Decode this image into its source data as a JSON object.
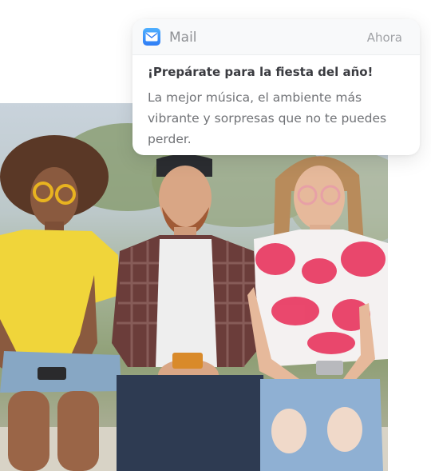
{
  "notification": {
    "app_name": "Mail",
    "app_icon": "mail-icon",
    "timestamp": "Ahora",
    "title": "¡Prepárate para la fiesta del año!",
    "body": "La mejor música, el ambiente más vibrante y sorpresas que no te puedes perder."
  },
  "photo": {
    "subject": "three-friends-looking-at-phones"
  },
  "colors": {
    "mail_icon_top": "#4fb0ff",
    "mail_icon_bottom": "#2f7cf5",
    "title_text": "#3a3b40",
    "body_text": "#707276",
    "meta_text": "#8e9094"
  }
}
